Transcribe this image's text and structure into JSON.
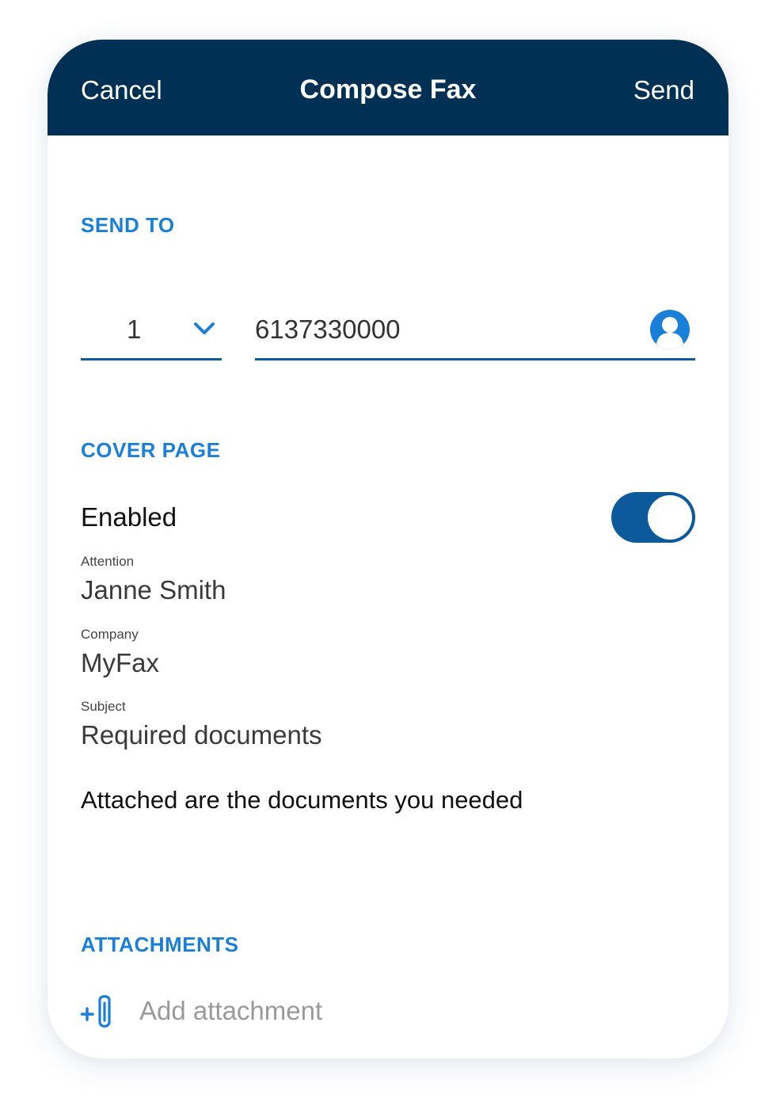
{
  "header": {
    "cancel_label": "Cancel",
    "title": "Compose Fax",
    "send_label": "Send",
    "background_color": "#003154"
  },
  "send_to": {
    "section_label": "SEND TO",
    "country_code": "1",
    "country_dropdown_icon": "chevron-down-icon",
    "fax_number": "6137330000",
    "contact_icon": "contact-person-icon"
  },
  "cover_page": {
    "section_label": "COVER PAGE",
    "enabled_label": "Enabled",
    "enabled": true,
    "attention_label": "Attention",
    "attention_value": "Janne Smith",
    "company_label": "Company",
    "company_value": "MyFax",
    "subject_label": "Subject",
    "subject_value": "Required documents",
    "message": "Attached are the documents you needed"
  },
  "attachments": {
    "section_label": "ATTACHMENTS",
    "add_label": "Add attachment",
    "add_icon": "add-paperclip-icon"
  },
  "colors": {
    "accent": "#1a7fd9",
    "underline": "#0a5a9c",
    "toggle_on": "#0c5a9b"
  }
}
